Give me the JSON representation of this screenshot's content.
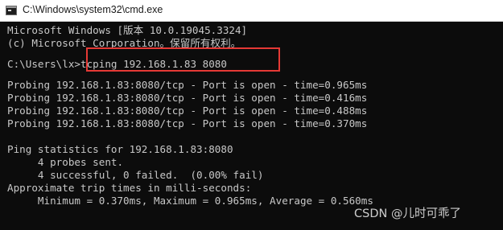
{
  "window": {
    "title": "C:\\Windows\\system32\\cmd.exe",
    "icon": "console-app-icon"
  },
  "console": {
    "header": [
      "Microsoft Windows [版本 10.0.19045.3324]",
      "(c) Microsoft Corporation。保留所有权利。"
    ],
    "prompt_path": "C:\\Users\\lx",
    "command": ">tcping 192.168.1.83 8080",
    "probes": [
      "Probing 192.168.1.83:8080/tcp - Port is open - time=0.965ms",
      "Probing 192.168.1.83:8080/tcp - Port is open - time=0.416ms",
      "Probing 192.168.1.83:8080/tcp - Port is open - time=0.488ms",
      "Probing 192.168.1.83:8080/tcp - Port is open - time=0.370ms"
    ],
    "stats": [
      "Ping statistics for 192.168.1.83:8080",
      "     4 probes sent.",
      "     4 successful, 0 failed.  (0.00% fail)",
      "Approximate trip times in milli-seconds:",
      "     Minimum = 0.370ms, Maximum = 0.965ms, Average = 0.560ms"
    ]
  },
  "annotation": {
    "highlight_color": "#e53935"
  },
  "watermark": "CSDN @儿时可乖了"
}
